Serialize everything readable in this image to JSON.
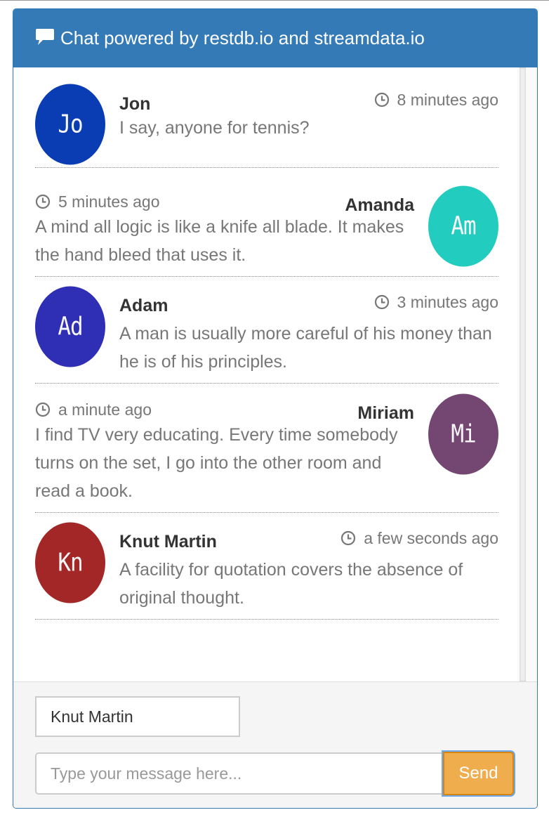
{
  "header": {
    "title": "Chat powered by restdb.io and streamdata.io",
    "icon": "comment-icon"
  },
  "messages": [
    {
      "initials": "Jo",
      "name": "Jon",
      "time": "8 minutes ago",
      "text": "I say, anyone for tennis?",
      "avatar_color": "#0a3db3",
      "side": "left"
    },
    {
      "initials": "Am",
      "name": "Amanda",
      "time": "5 minutes ago",
      "text": "A mind all logic is like a knife all blade. It makes the hand bleed that uses it.",
      "avatar_color": "#22cdc0",
      "side": "right"
    },
    {
      "initials": "Ad",
      "name": "Adam",
      "time": "3 minutes ago",
      "text": "A man is usually more careful of his money than he is of his principles.",
      "avatar_color": "#2e2fb4",
      "side": "left"
    },
    {
      "initials": "Mi",
      "name": "Miriam",
      "time": "a minute ago",
      "text": "I find TV very educating. Every time somebody turns on the set, I go into the other room and read a book.",
      "avatar_color": "#744772",
      "side": "right"
    },
    {
      "initials": "Kn",
      "name": "Knut Martin",
      "time": "a few seconds ago",
      "text": "A facility for quotation covers the absence of original thought.",
      "avatar_color": "#a32727",
      "side": "left"
    }
  ],
  "footer": {
    "name_value": "Knut Martin",
    "message_placeholder": "Type your message here...",
    "send_label": "Send",
    "send_color": "#f0ad4e"
  }
}
